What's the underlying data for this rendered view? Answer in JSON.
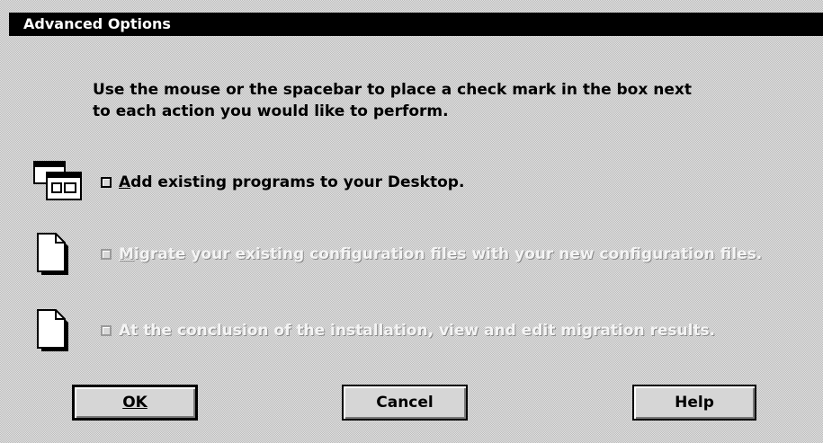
{
  "window": {
    "title": "Advanced Options"
  },
  "instructions": {
    "line1": "Use the mouse or the spacebar to place a check mark in the box next",
    "line2": "to each action you would like to perform."
  },
  "options": [
    {
      "mnemonic": "A",
      "label_rest": "dd existing programs to your Desktop.",
      "checked": false,
      "enabled": true,
      "icon": "programs-window-icon"
    },
    {
      "mnemonic": "M",
      "label_rest": "igrate your existing configuration files with your new configuration files.",
      "checked": false,
      "enabled": false,
      "icon": "document-icon"
    },
    {
      "mnemonic": "",
      "label_rest": "At the conclusion of the installation,  view and edit migration results.",
      "checked": false,
      "enabled": false,
      "icon": "document-icon"
    }
  ],
  "buttons": {
    "ok": "OK",
    "cancel": "Cancel",
    "help": "Help"
  }
}
